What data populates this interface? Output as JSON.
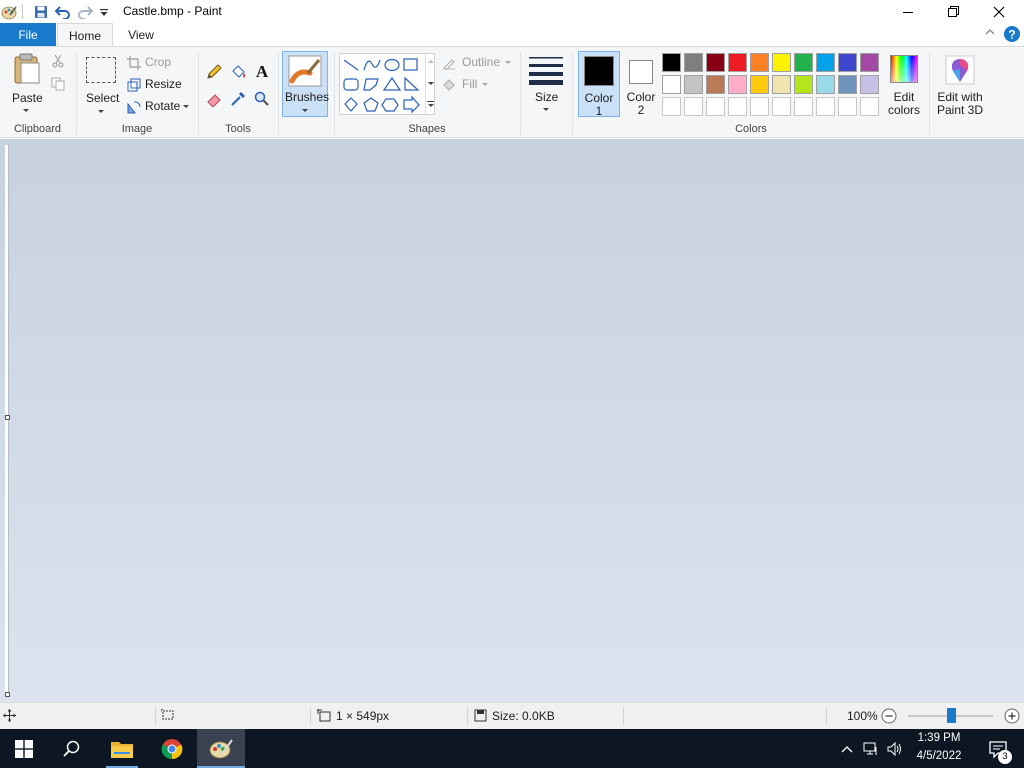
{
  "window": {
    "title": "Castle.bmp - Paint",
    "icons": [
      "paint-app-icon",
      "save-icon",
      "undo-icon",
      "redo-icon",
      "customize-quick-access-icon"
    ],
    "controls": [
      "minimize-icon",
      "maximize-icon",
      "close-icon"
    ]
  },
  "tabs": {
    "file": "File",
    "home": "Home",
    "view": "View"
  },
  "ribbon": {
    "clipboard": {
      "paste": "Paste",
      "group": "Clipboard"
    },
    "image": {
      "select": "Select",
      "crop": "Crop",
      "resize": "Resize",
      "rotate": "Rotate",
      "group": "Image"
    },
    "tools": {
      "group": "Tools"
    },
    "brushes": {
      "label": "Brushes"
    },
    "shapes": {
      "outline": "Outline",
      "fill": "Fill",
      "group": "Shapes"
    },
    "size": {
      "label": "Size"
    },
    "colors": {
      "color1": "Color",
      "color1_num": "1",
      "color2": "Color",
      "color2_num": "2",
      "edit_colors_1": "Edit",
      "edit_colors_2": "colors",
      "paint3d_1": "Edit with",
      "paint3d_2": "Paint 3D",
      "group": "Colors",
      "color1_value": "#000000",
      "color2_value": "#ffffff",
      "palette_row1": [
        "#000000",
        "#7f7f7f",
        "#880015",
        "#ed1c24",
        "#ff7f27",
        "#fff200",
        "#22b14c",
        "#00a2e8",
        "#3f48cc",
        "#a349a4"
      ],
      "palette_row2": [
        "#ffffff",
        "#c3c3c3",
        "#b97a57",
        "#ffaec9",
        "#ffc90e",
        "#efe4b0",
        "#b5e61d",
        "#99d9ea",
        "#7092be",
        "#c8bfe7"
      ],
      "palette_row3": [
        "#ffffff",
        "#ffffff",
        "#ffffff",
        "#ffffff",
        "#ffffff",
        "#ffffff",
        "#ffffff",
        "#ffffff",
        "#ffffff",
        "#ffffff"
      ]
    }
  },
  "status": {
    "dimensions": "1 × 549px",
    "size": "Size: 0.0KB",
    "zoom": "100%",
    "zoom_level": 0.5
  },
  "taskbar": {
    "time": "1:39 PM",
    "date": "4/5/2022",
    "notifications": "3"
  },
  "accent": "#1979ca"
}
